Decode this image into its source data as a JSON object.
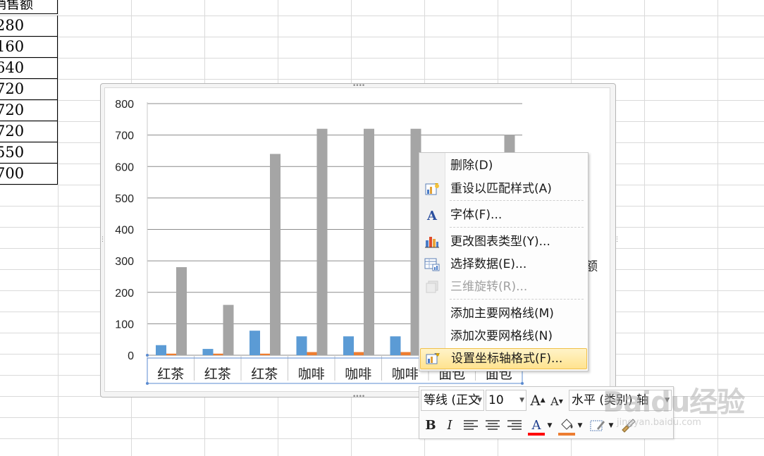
{
  "sheet": {
    "header": "销售额",
    "values": [
      "280",
      "160",
      "640",
      "720",
      "720",
      "720",
      "550",
      "700"
    ]
  },
  "chart_data": {
    "type": "bar",
    "categories": [
      "红茶",
      "红茶",
      "红茶",
      "咖啡",
      "咖啡",
      "咖啡",
      "面包",
      "面包"
    ],
    "series": [
      {
        "values": [
          32,
          20,
          78,
          60,
          60,
          60,
          null,
          null
        ],
        "color": "#5b9bd5"
      },
      {
        "values": [
          5,
          5,
          5,
          10,
          10,
          10,
          null,
          null
        ],
        "color": "#ed7d31"
      },
      {
        "values": [
          280,
          160,
          640,
          720,
          720,
          720,
          null,
          700
        ],
        "color": "#a5a5a5"
      }
    ],
    "ylim": [
      0,
      800
    ],
    "yticks": [
      "0",
      "100",
      "200",
      "300",
      "400",
      "500",
      "600",
      "700",
      "800"
    ],
    "grid": true,
    "legend_partial": "额"
  },
  "context_menu": {
    "items": [
      {
        "label": "删除(D)",
        "mnemonic": "D",
        "icon": null,
        "enabled": true
      },
      {
        "label": "重设以匹配样式(A)",
        "mnemonic": "A",
        "icon": "reset-style-icon",
        "enabled": true
      },
      {
        "label": "字体(F)...",
        "mnemonic": "F",
        "icon": "font-icon",
        "enabled": true
      },
      {
        "label": "更改图表类型(Y)...",
        "mnemonic": "Y",
        "icon": "chart-type-icon",
        "enabled": true
      },
      {
        "label": "选择数据(E)...",
        "mnemonic": "E",
        "icon": "select-data-icon",
        "enabled": true
      },
      {
        "label": "三维旋转(R)...",
        "mnemonic": "R",
        "icon": "3d-rotation-icon",
        "enabled": false
      },
      {
        "label": "添加主要网格线(M)",
        "mnemonic": "M",
        "icon": null,
        "enabled": true
      },
      {
        "label": "添加次要网格线(N)",
        "mnemonic": "N",
        "icon": null,
        "enabled": true
      },
      {
        "label": "设置坐标轴格式(F)...",
        "mnemonic": "F",
        "icon": "format-axis-icon",
        "enabled": true,
        "highlighted": true
      }
    ]
  },
  "mini_toolbar": {
    "font_name": "等线 (正文",
    "font_size": "10",
    "grow_font": "A",
    "shrink_font": "A",
    "element_select": "水平 (类别) 轴",
    "bold": "B",
    "italic": "I",
    "font_color_letter": "A",
    "font_color": "#ff0000",
    "fill_color": "#ed7d31"
  },
  "watermark": {
    "text": "Baidu经验",
    "url": "jingyan.baidu.com"
  }
}
